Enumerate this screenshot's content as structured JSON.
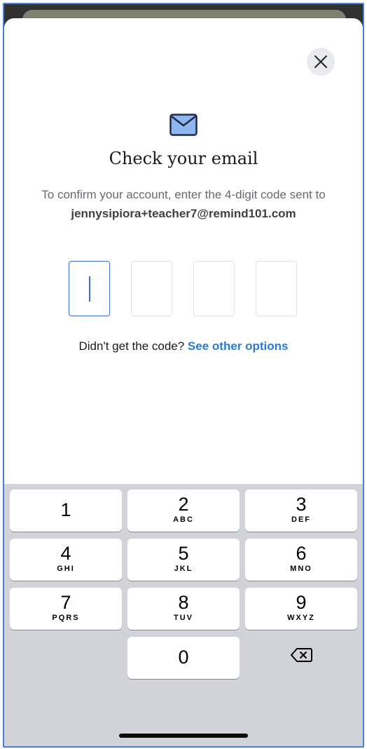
{
  "modal": {
    "title": "Check your email",
    "message": "To confirm your account, enter the 4-digit code sent to",
    "email": "jennysipiora+teacher7@remind101.com",
    "close_icon": "close-icon",
    "mail_icon": "envelope-icon"
  },
  "code_entry": {
    "digits": [
      "",
      "",
      "",
      ""
    ],
    "active_index": 0
  },
  "resend": {
    "prompt": "Didn't get the code?",
    "link": "See other options"
  },
  "keyboard": {
    "keys": [
      {
        "digit": "1",
        "letters": ""
      },
      {
        "digit": "2",
        "letters": "ABC"
      },
      {
        "digit": "3",
        "letters": "DEF"
      },
      {
        "digit": "4",
        "letters": "GHI"
      },
      {
        "digit": "5",
        "letters": "JKL"
      },
      {
        "digit": "6",
        "letters": "MNO"
      },
      {
        "digit": "7",
        "letters": "PQRS"
      },
      {
        "digit": "8",
        "letters": "TUV"
      },
      {
        "digit": "9",
        "letters": "WXYZ"
      },
      {
        "digit": "0",
        "letters": ""
      }
    ],
    "delete_icon": "backspace-icon"
  },
  "colors": {
    "accent": "#3b6fd1",
    "link": "#2d7ad6",
    "keyboard_bg": "#d1d3d9"
  }
}
